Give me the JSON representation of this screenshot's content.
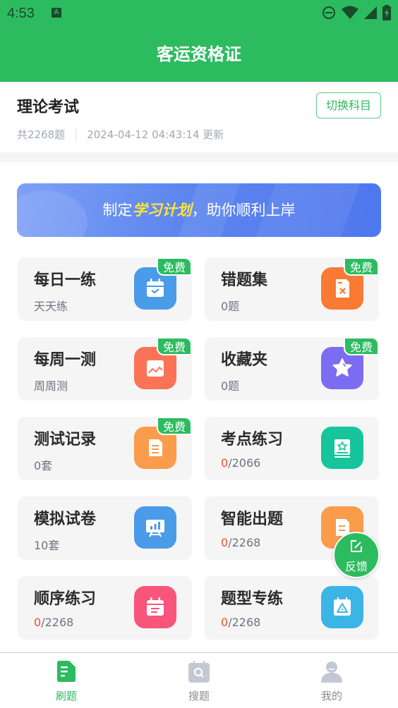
{
  "status_bar": {
    "time": "4:53",
    "notification_icon": "a-icon",
    "icons": [
      "do-not-disturb-icon",
      "wifi-icon",
      "signal-icon",
      "battery-charging-icon"
    ]
  },
  "header": {
    "title": "客运资格证"
  },
  "subject": {
    "title": "理论考试",
    "switch_label": "切换科目",
    "total": "共2268题",
    "updated": "2024-04-12 04:43:14 更新"
  },
  "banner": {
    "prefix": "制定",
    "highlight": "学习计划",
    "suffix": "，助你顺利上岸"
  },
  "cards": [
    {
      "title": "每日一练",
      "sub": "天天练",
      "badge": "免费",
      "icon": "calendar-check-icon",
      "color": "#4a9be8"
    },
    {
      "title": "错题集",
      "sub": "0题",
      "badge": "免费",
      "icon": "wrong-doc-icon",
      "color": "#f97a35"
    },
    {
      "title": "每周一测",
      "sub": "周周测",
      "badge": "免费",
      "icon": "chart-calendar-icon",
      "color": "#fb7356"
    },
    {
      "title": "收藏夹",
      "sub": "0题",
      "badge": "免费",
      "icon": "star-icon",
      "color": "#7b6cf2"
    },
    {
      "title": "测试记录",
      "sub": "0套",
      "badge": "免费",
      "icon": "document-icon",
      "color": "#fb9b4c"
    },
    {
      "title": "考点练习",
      "sub_done": "0",
      "sub_total": "/2066",
      "icon": "star-book-icon",
      "color": "#16c59c"
    },
    {
      "title": "模拟试卷",
      "sub": "10套",
      "icon": "presentation-icon",
      "color": "#4a9be8"
    },
    {
      "title": "智能出题",
      "sub_done": "0",
      "sub_total": "/2268",
      "icon": "smart-doc-icon",
      "color": "#fb9b4c"
    },
    {
      "title": "顺序练习",
      "sub_done": "0",
      "sub_total": "/2268",
      "icon": "list-calendar-icon",
      "color": "#f8557a"
    },
    {
      "title": "题型专练",
      "sub_done": "0",
      "sub_total": "/2268",
      "icon": "triangle-calendar-icon",
      "color": "#3bb5e6"
    }
  ],
  "fab": {
    "label": "反馈",
    "icon": "edit-icon"
  },
  "bottom_nav": [
    {
      "label": "刷题",
      "icon": "practice-icon",
      "active": true
    },
    {
      "label": "搜题",
      "icon": "search-question-icon",
      "active": false
    },
    {
      "label": "我的",
      "icon": "profile-icon",
      "active": false
    }
  ],
  "colors": {
    "brand": "#2dbb60",
    "progress_done": "#e8542a",
    "badge": "#2dbb60"
  }
}
